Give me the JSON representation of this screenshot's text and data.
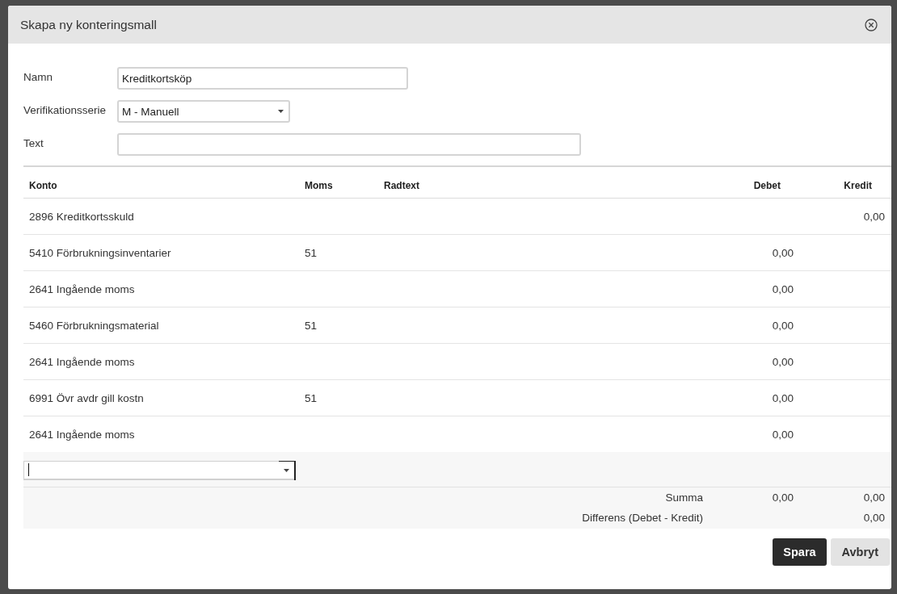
{
  "dialog": {
    "title": "Skapa ny konteringsmall"
  },
  "form": {
    "fields": [
      {
        "label": "Namn",
        "kind": "text",
        "value": "Kreditkortsköp"
      },
      {
        "label": "Verifikationsserie",
        "kind": "select",
        "value": "M - Manuell"
      },
      {
        "label": "Text",
        "kind": "text"
      }
    ]
  },
  "table": {
    "columns": [
      "Konto",
      "Moms",
      "Radtext",
      "Debet",
      "Kredit"
    ],
    "rows": [
      {
        "konto": "2896 Kreditkortsskuld",
        "kredit": "0,00"
      },
      {
        "konto": "5410 Förbrukningsinventarier",
        "moms": "51",
        "debet": "0,00"
      },
      {
        "konto": "2641 Ingående moms",
        "debet": "0,00"
      },
      {
        "konto": "5460 Förbrukningsmaterial",
        "moms": "51",
        "debet": "0,00"
      },
      {
        "konto": "2641 Ingående moms",
        "debet": "0,00"
      },
      {
        "konto": "6991 Övr avdr gill kostn",
        "moms": "51",
        "debet": "0,00"
      },
      {
        "konto": "2641 Ingående moms",
        "debet": "0,00"
      }
    ],
    "entry_row": {
      "focused": true
    },
    "summary": [
      {
        "label": "Summa",
        "debet": "0,00",
        "kredit": "0,00"
      },
      {
        "label": "Differens (Debet - Kredit)",
        "kredit": "0,00"
      }
    ]
  },
  "buttons": [
    {
      "label": "Spara",
      "kind": "primary"
    },
    {
      "label": "Avbryt",
      "kind": "secondary"
    }
  ]
}
